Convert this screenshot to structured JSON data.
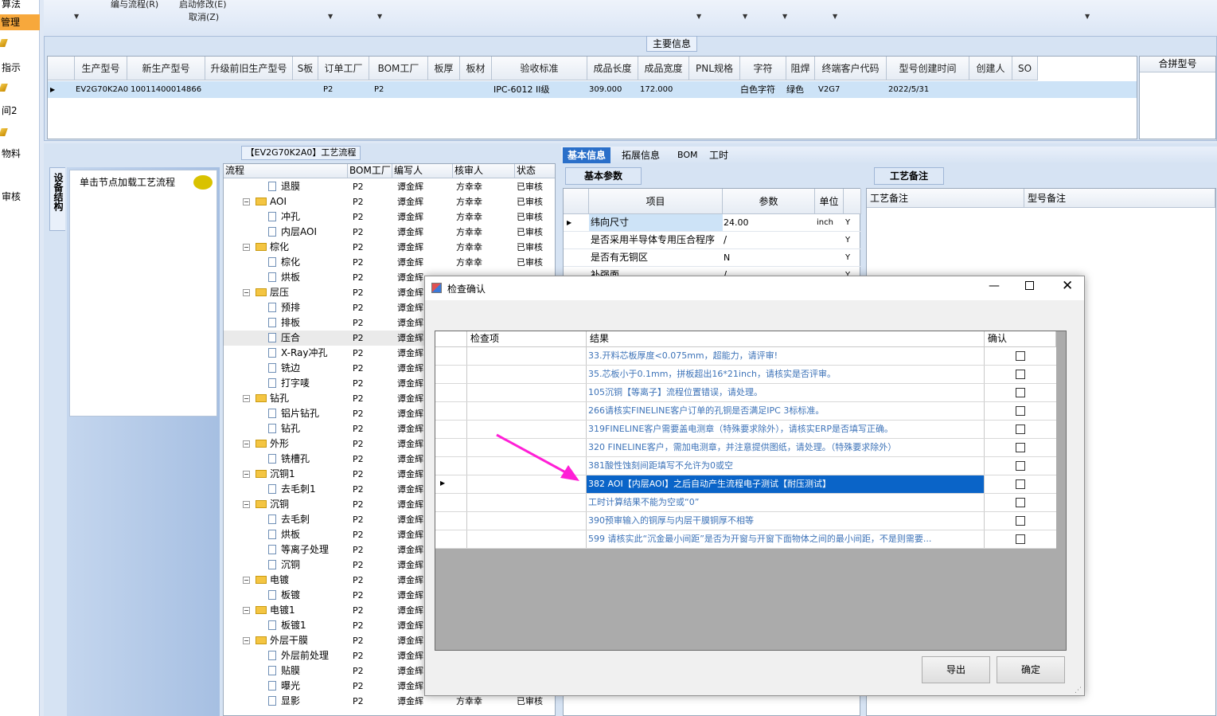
{
  "left_nav": {
    "items": [
      "算法",
      "管理",
      "指示",
      "间2",
      "物料",
      "审核"
    ],
    "selected": "管理"
  },
  "toolbar": {
    "edit_flow": "编与流程(R)",
    "start_modify": "启动修改(E)",
    "cancel": "取消(Z)"
  },
  "main_info": {
    "title": "主要信息",
    "columns": [
      "生产型号",
      "新生产型号",
      "升级前旧生产型号",
      "S板",
      "订单工厂",
      "BOM工厂",
      "板厚",
      "板材",
      "验收标准",
      "成品长度",
      "成品宽度",
      "PNL规格",
      "字符",
      "阻焊",
      "终端客户代码",
      "型号创建时间",
      "创建人",
      "SO"
    ],
    "row": {
      "prod_model": "EV2G70K2A0",
      "new_model": "10011400014866",
      "order_factory": "P2",
      "bom_factory": "P2",
      "standard": "IPC-6012 II级",
      "length": "309.000",
      "width": "172.000",
      "char": "白色字符",
      "solder": "绿色",
      "customer": "V2G7",
      "created": "2022/5/31"
    },
    "side_header": "合拼型号"
  },
  "process": {
    "title": "【EV2G70K2A0】工艺流程",
    "vertical_tab": "设备结构",
    "node_hint": "单击节点加载工艺流程",
    "columns": [
      "流程",
      "BOM工厂",
      "编写人",
      "核审人",
      "状态"
    ],
    "rows": [
      {
        "name": "退膜",
        "type": "doc",
        "depth": 2,
        "bom": "P2",
        "writer": "谭金辉",
        "reviewer": "方幸幸",
        "status": "已审核"
      },
      {
        "name": "AOI",
        "type": "folder",
        "depth": 1,
        "bom": "P2",
        "writer": "谭金辉",
        "reviewer": "方幸幸",
        "status": "已审核"
      },
      {
        "name": "冲孔",
        "type": "doc",
        "depth": 2,
        "bom": "P2",
        "writer": "谭金辉",
        "reviewer": "方幸幸",
        "status": "已审核"
      },
      {
        "name": "内层AOI",
        "type": "doc",
        "depth": 2,
        "bom": "P2",
        "writer": "谭金辉",
        "reviewer": "方幸幸",
        "status": "已审核"
      },
      {
        "name": "棕化",
        "type": "folder",
        "depth": 1,
        "bom": "P2",
        "writer": "谭金辉",
        "reviewer": "方幸幸",
        "status": "已审核"
      },
      {
        "name": "棕化",
        "type": "doc",
        "depth": 2,
        "bom": "P2",
        "writer": "谭金辉",
        "reviewer": "方幸幸",
        "status": "已审核"
      },
      {
        "name": "烘板",
        "type": "doc",
        "depth": 2,
        "bom": "P2",
        "writer": "谭金辉",
        "reviewer": "",
        "status": ""
      },
      {
        "name": "层压",
        "type": "folder",
        "depth": 1,
        "bom": "P2",
        "writer": "谭金辉",
        "reviewer": "",
        "status": ""
      },
      {
        "name": "预排",
        "type": "doc",
        "depth": 2,
        "bom": "P2",
        "writer": "谭金辉",
        "reviewer": "",
        "status": ""
      },
      {
        "name": "排板",
        "type": "doc",
        "depth": 2,
        "bom": "P2",
        "writer": "谭金辉",
        "reviewer": "",
        "status": ""
      },
      {
        "name": "压合",
        "type": "doc",
        "depth": 2,
        "bom": "P2",
        "writer": "谭金辉",
        "reviewer": "",
        "status": ""
      },
      {
        "name": "X-Ray冲孔",
        "type": "doc",
        "depth": 2,
        "bom": "P2",
        "writer": "谭金辉",
        "reviewer": "",
        "status": ""
      },
      {
        "name": "铣边",
        "type": "doc",
        "depth": 2,
        "bom": "P2",
        "writer": "谭金辉",
        "reviewer": "",
        "status": ""
      },
      {
        "name": "打字唛",
        "type": "doc",
        "depth": 2,
        "bom": "P2",
        "writer": "谭金辉",
        "reviewer": "",
        "status": ""
      },
      {
        "name": "钻孔",
        "type": "folder",
        "depth": 1,
        "bom": "P2",
        "writer": "谭金辉",
        "reviewer": "",
        "status": ""
      },
      {
        "name": "铝片钻孔",
        "type": "doc",
        "depth": 2,
        "bom": "P2",
        "writer": "谭金辉",
        "reviewer": "",
        "status": ""
      },
      {
        "name": "钻孔",
        "type": "doc",
        "depth": 2,
        "bom": "P2",
        "writer": "谭金辉",
        "reviewer": "",
        "status": ""
      },
      {
        "name": "外形",
        "type": "folder",
        "depth": 1,
        "bom": "P2",
        "writer": "谭金辉",
        "reviewer": "",
        "status": ""
      },
      {
        "name": "铣槽孔",
        "type": "doc",
        "depth": 2,
        "bom": "P2",
        "writer": "谭金辉",
        "reviewer": "",
        "status": ""
      },
      {
        "name": "沉铜1",
        "type": "folder",
        "depth": 1,
        "bom": "P2",
        "writer": "谭金辉",
        "reviewer": "",
        "status": ""
      },
      {
        "name": "去毛刺1",
        "type": "doc",
        "depth": 2,
        "bom": "P2",
        "writer": "谭金辉",
        "reviewer": "",
        "status": ""
      },
      {
        "name": "沉铜",
        "type": "folder",
        "depth": 1,
        "bom": "P2",
        "writer": "谭金辉",
        "reviewer": "",
        "status": ""
      },
      {
        "name": "去毛刺",
        "type": "doc",
        "depth": 2,
        "bom": "P2",
        "writer": "谭金辉",
        "reviewer": "",
        "status": ""
      },
      {
        "name": "烘板",
        "type": "doc",
        "depth": 2,
        "bom": "P2",
        "writer": "谭金辉",
        "reviewer": "",
        "status": ""
      },
      {
        "name": "等离子处理",
        "type": "doc",
        "depth": 2,
        "bom": "P2",
        "writer": "谭金辉",
        "reviewer": "",
        "status": ""
      },
      {
        "name": "沉铜",
        "type": "doc",
        "depth": 2,
        "bom": "P2",
        "writer": "谭金辉",
        "reviewer": "",
        "status": ""
      },
      {
        "name": "电镀",
        "type": "folder",
        "depth": 1,
        "bom": "P2",
        "writer": "谭金辉",
        "reviewer": "",
        "status": ""
      },
      {
        "name": "板镀",
        "type": "doc",
        "depth": 2,
        "bom": "P2",
        "writer": "谭金辉",
        "reviewer": "",
        "status": ""
      },
      {
        "name": "电镀1",
        "type": "folder",
        "depth": 1,
        "bom": "P2",
        "writer": "谭金辉",
        "reviewer": "",
        "status": ""
      },
      {
        "name": "板镀1",
        "type": "doc",
        "depth": 2,
        "bom": "P2",
        "writer": "谭金辉",
        "reviewer": "",
        "status": ""
      },
      {
        "name": "外层干膜",
        "type": "folder",
        "depth": 1,
        "bom": "P2",
        "writer": "谭金辉",
        "reviewer": "",
        "status": ""
      },
      {
        "name": "外层前处理",
        "type": "doc",
        "depth": 2,
        "bom": "P2",
        "writer": "谭金辉",
        "reviewer": "",
        "status": ""
      },
      {
        "name": "贴膜",
        "type": "doc",
        "depth": 2,
        "bom": "P2",
        "writer": "谭金辉",
        "reviewer": "",
        "status": ""
      },
      {
        "name": "曝光",
        "type": "doc",
        "depth": 2,
        "bom": "P2",
        "writer": "谭金辉",
        "reviewer": "",
        "status": ""
      },
      {
        "name": "显影",
        "type": "doc",
        "depth": 2,
        "bom": "P2",
        "writer": "谭金辉",
        "reviewer": "方幸幸",
        "status": "已审核"
      }
    ]
  },
  "right_tabs": [
    "基本信息",
    "拓展信息",
    "BOM",
    "工时"
  ],
  "basic_params": {
    "tab": "基本参数",
    "columns": [
      "项目",
      "参数",
      "单位"
    ],
    "rows": [
      {
        "item": "纬向尺寸",
        "value": "24.00",
        "unit": "inch",
        "flag": "Y"
      },
      {
        "item": "是否采用半导体专用压合程序",
        "value": "/",
        "unit": "",
        "flag": "Y"
      },
      {
        "item": "是否有无铜区",
        "value": "N",
        "unit": "",
        "flag": "Y"
      },
      {
        "item": "补强面",
        "value": "/",
        "unit": "",
        "flag": "Y"
      }
    ]
  },
  "process_remark": {
    "tab": "工艺备注",
    "columns": [
      "工艺备注",
      "型号备注"
    ]
  },
  "dialog": {
    "title": "检查确认",
    "columns": [
      "检查项",
      "结果",
      "确认"
    ],
    "rows": [
      "33.开料芯板厚度<0.075mm，超能力，请评审!",
      "35.芯板小于0.1mm，拼板超出16*21inch，请核实是否评审。",
      "105沉铜【等离子】流程位置错误，请处理。",
      "266请核实FINELINE客户订单的孔铜是否满足IPC 3标标准。",
      "319FINELINE客户需要盖电测章（特殊要求除外），请核实ERP是否填写正确。",
      "320 FINELINE客户，需加电测章，并注意提供图纸，请处理。（特殊要求除外）",
      "381酸性蚀刻间距填写不允许为0或空",
      "382 AOI【内层AOI】之后自动产生流程电子测试【耐压测试】",
      "工时计算结果不能为空或“0”",
      "390预审输入的铜厚与内层干膜铜厚不相等",
      "599 请核实此“沉金最小间距”是否为开窗与开窗下面物体之间的最小间距，不是则需要..."
    ],
    "selected_index": 7,
    "export_label": "导出",
    "confirm_label": "确定"
  }
}
